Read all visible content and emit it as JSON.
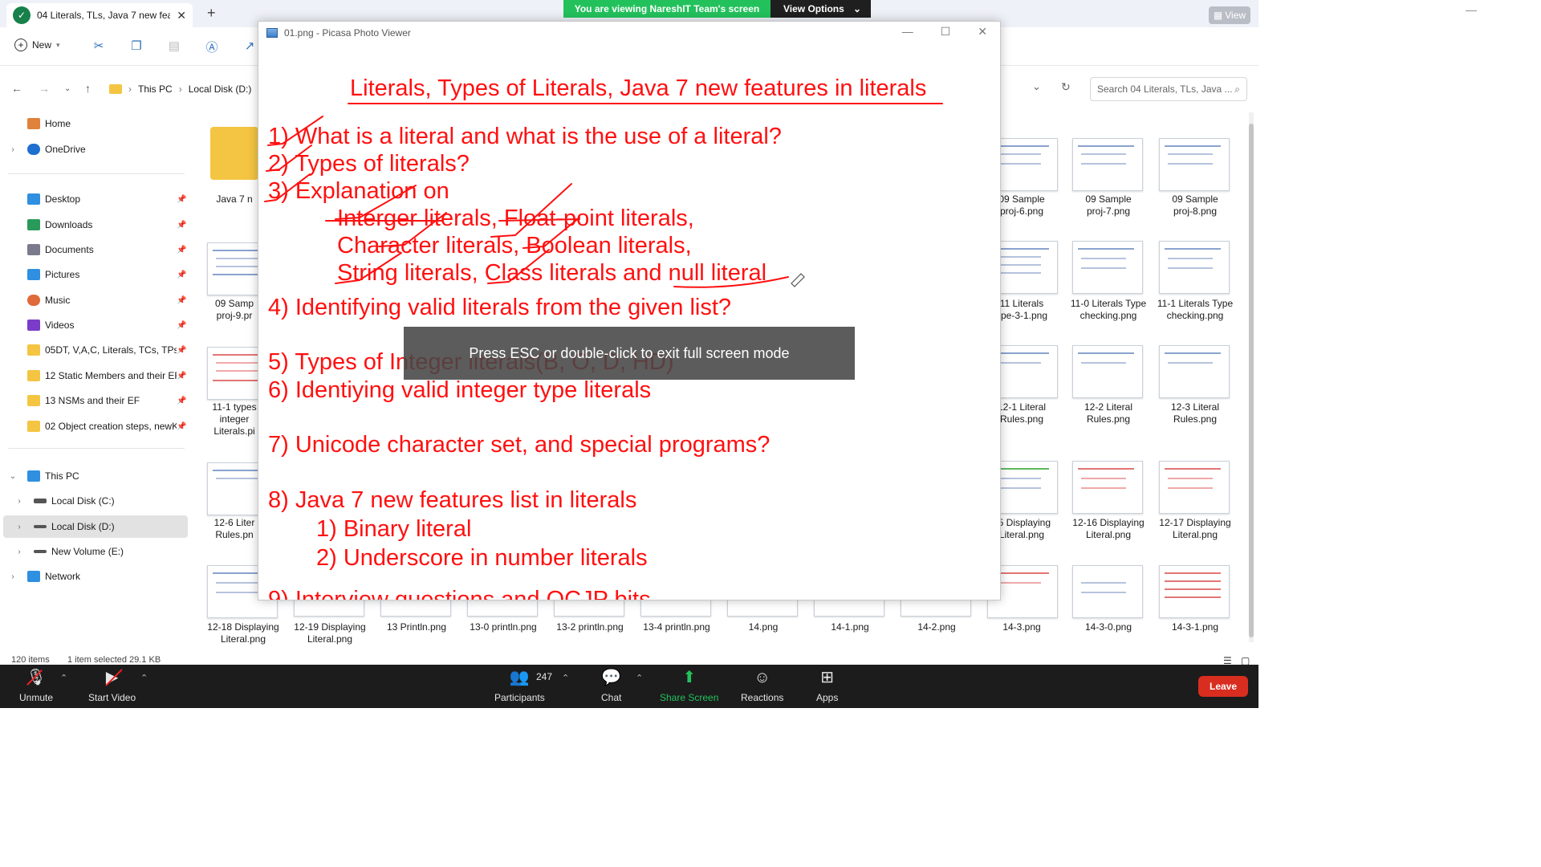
{
  "explorer": {
    "tab_title": "04 Literals, TLs, Java 7 new fea",
    "new_label": "New",
    "breadcrumb": [
      "This PC",
      "Local Disk (D:)"
    ],
    "search_placeholder": "Search 04 Literals, TLs, Java ...",
    "view_label": "View",
    "sidebar": {
      "quick": [
        {
          "label": "Home",
          "color": "#e0823c"
        },
        {
          "label": "OneDrive",
          "color": "#1e6fd0"
        }
      ],
      "pinned": [
        {
          "label": "Desktop",
          "color": "#2f8fe0"
        },
        {
          "label": "Downloads",
          "color": "#2a9a5a"
        },
        {
          "label": "Documents",
          "color": "#7a7a8c"
        },
        {
          "label": "Pictures",
          "color": "#2f8fe0"
        },
        {
          "label": "Music",
          "color": "#e06a3a"
        },
        {
          "label": "Videos",
          "color": "#7a3cc9"
        },
        {
          "label": "05DT, V,A,C, Literals, TCs, TPs",
          "color": "#f4c542"
        },
        {
          "label": "12 Static Members and their EF",
          "color": "#f4c542"
        },
        {
          "label": "13 NSMs and their EF",
          "color": "#f4c542"
        },
        {
          "label": "02 Object creation steps, newKw",
          "color": "#f4c542"
        }
      ],
      "this_pc": {
        "label": "This PC",
        "color": "#2f8fe0"
      },
      "drives": [
        {
          "label": "Local Disk (C:)",
          "color": "#555"
        },
        {
          "label": "Local Disk (D:)",
          "color": "#555"
        },
        {
          "label": "New Volume (E:)",
          "color": "#555"
        }
      ],
      "network": {
        "label": "Network",
        "color": "#2f8fe0"
      }
    },
    "files_left": [
      "Java 7 n",
      "09 Samp\nproj-9.pr",
      "11-1 types\ninteger\nLiterals.pi",
      "12-6 Liter\nRules.pn",
      "12-18 Displaying\nLiteral.png"
    ],
    "files_bottom": [
      "12-19 Displaying\nLiteral.png",
      "13 Println.png",
      "13-0 println.png",
      "13-2 println.png",
      "13-4 println.png",
      "14.png",
      "14-1.png",
      "14-2.png",
      "14-3.png",
      "14-3-0.png",
      "14-3-1.png"
    ],
    "files_right": [
      [
        "09 Sample\nproj-6.png",
        "09 Sample\nproj-7.png",
        "09 Sample\nproj-8.png"
      ],
      [
        "11 Literals\nype-3-1.png",
        "11-0 Literals Type\nchecking.png",
        "11-1 Literals Type\nchecking.png"
      ],
      [
        "12-1 Literal\nRules.png",
        "12-2 Literal\nRules.png",
        "12-3 Literal\nRules.png"
      ],
      [
        "15 Displaying\nLiteral.png",
        "12-16 Displaying\nLiteral.png",
        "12-17 Displaying\nLiteral.png"
      ]
    ],
    "status_items": "120 items",
    "status_selected": "1 item selected  29.1 KB"
  },
  "picasa": {
    "title": "01.png - Picasa Photo Viewer",
    "lines": [
      "Literals, Types of Literals, Java 7 new features in literals",
      "1) What is a literal and what is the use of a literal?",
      "2) Types of literals?",
      "3) Explanation on",
      "Interger literals, Float-point literals,",
      "Character literals, Boolean literals,",
      "String literals, Class literals and null literal",
      "4) Identifying valid literals from the given list?",
      "5) Types of Integer literals(B, O, D, HD)",
      "6) Identiying valid integer type literals",
      "7) Unicode character set, and special programs?",
      "8) Java 7 new features list in literals",
      "1) Binary literal",
      "2) Underscore in number literals",
      "9) Interview questions and OCJP bits"
    ],
    "ink_color": "#ff1010"
  },
  "fullscreen_hint": "Press ESC or double-click to exit full screen mode",
  "share_banner": {
    "text": "You are viewing NareshIT Team's screen",
    "options": "View Options"
  },
  "zoom": {
    "unmute": "Unmute",
    "start_video": "Start Video",
    "participants": "Participants",
    "participant_count": "247",
    "chat": "Chat",
    "share_screen": "Share Screen",
    "reactions": "Reactions",
    "apps": "Apps",
    "leave": "Leave"
  }
}
